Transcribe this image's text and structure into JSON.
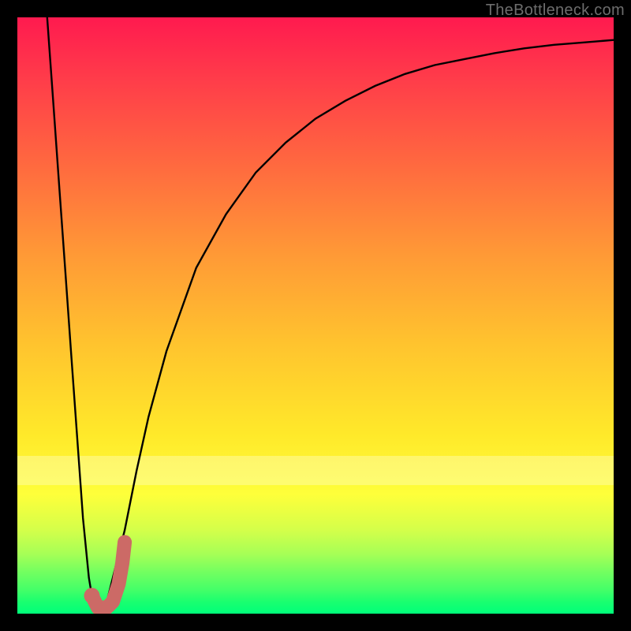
{
  "watermark": "TheBottleneck.com",
  "chart_data": {
    "type": "line",
    "title": "",
    "xlabel": "",
    "ylabel": "",
    "xlim": [
      0,
      100
    ],
    "ylim": [
      0,
      100
    ],
    "grid": false,
    "series": [
      {
        "name": "curve",
        "x": [
          5,
          6,
          7,
          8,
          9,
          10,
          11,
          12,
          13,
          14,
          15,
          16,
          18,
          20,
          22,
          25,
          30,
          35,
          40,
          45,
          50,
          55,
          60,
          65,
          70,
          75,
          80,
          85,
          90,
          95,
          100
        ],
        "y": [
          100,
          86,
          72,
          58,
          44,
          30,
          16,
          6,
          0,
          0,
          2,
          6,
          14,
          24,
          33,
          44,
          58,
          67,
          74,
          79,
          83,
          86,
          88.5,
          90.5,
          92,
          93,
          94,
          94.8,
          95.4,
          95.8,
          96.2
        ]
      },
      {
        "name": "marker",
        "points": [
          {
            "x": 12.5,
            "y": 3.0
          },
          {
            "x": 13.5,
            "y": 1.0
          },
          {
            "x": 15.0,
            "y": 1.0
          },
          {
            "x": 16.0,
            "y": 2.0
          },
          {
            "x": 17.0,
            "y": 5.0
          },
          {
            "x": 17.6,
            "y": 8.5
          },
          {
            "x": 18.0,
            "y": 12.0
          }
        ]
      }
    ],
    "colors": {
      "curve": "#000000",
      "marker": "#cc6a66",
      "gradient_top": "#ff1a4f",
      "gradient_mid": "#ffe92a",
      "gradient_bottom": "#00ff7a"
    }
  }
}
